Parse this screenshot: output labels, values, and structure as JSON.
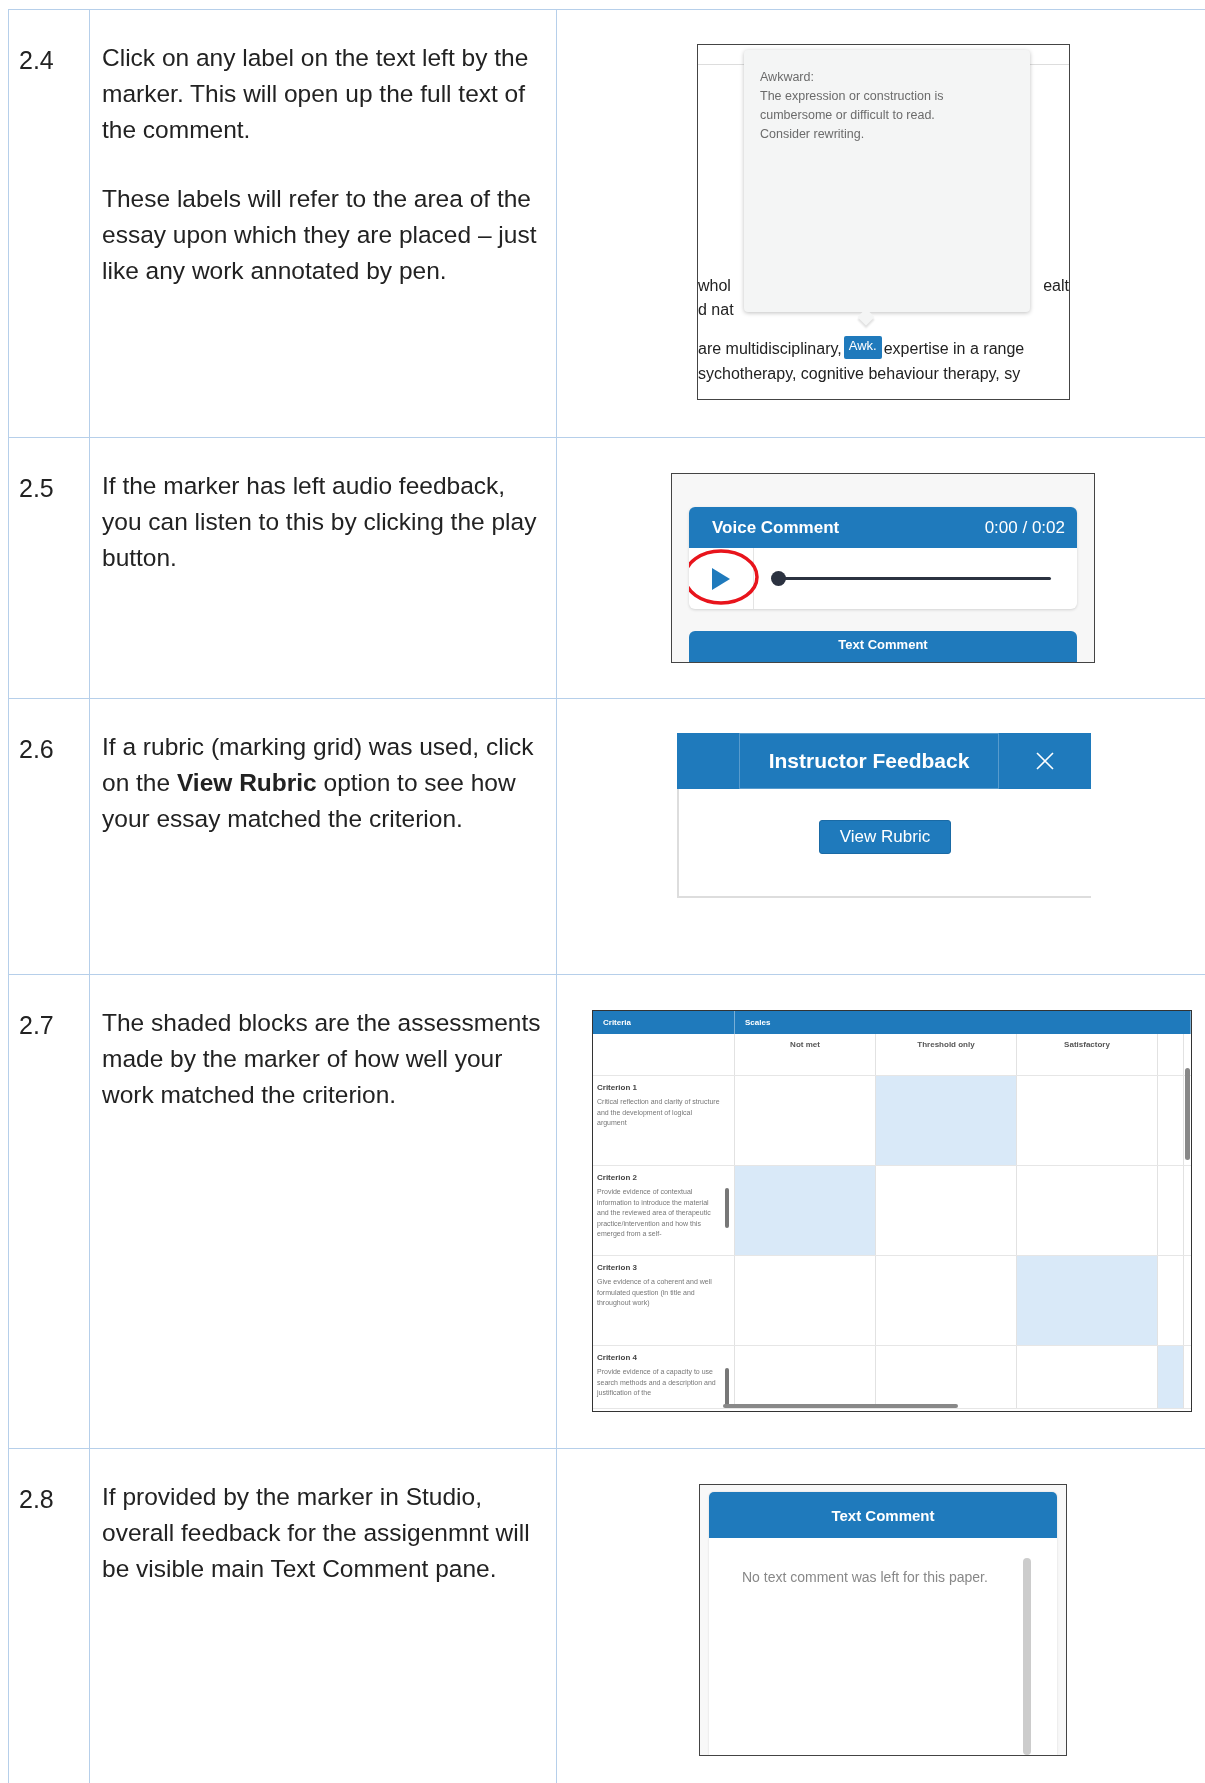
{
  "rows": [
    {
      "number": "2.4",
      "paragraphs": [
        "Click on any label on the text left by the marker. This will open up the full text of the comment.",
        "These labels will refer to the area of the essay upon which they are placed – just like any work annotated by pen."
      ],
      "figure": {
        "kind": "annotation",
        "popup_title": "Awkward:",
        "popup_lines": [
          "The expression or construction is",
          "cumbersome or difficult to read.",
          "Consider rewriting."
        ],
        "line_1_left": "whol",
        "line_1_right": "ealt",
        "line_2": "d nat",
        "line_3_before": "are multidisciplinary,",
        "tag": "Awk.",
        "line_3_after": "expertise in a range",
        "line_4": "sychotherapy, cognitive behaviour therapy, sy"
      }
    },
    {
      "number": "2.5",
      "paragraphs": [
        "If the marker has left audio feedback, you can listen to this by clicking the play button."
      ],
      "figure": {
        "kind": "voice",
        "title": "Voice Comment",
        "time": "0:00 / 0:02",
        "level": 0,
        "highlighted": true,
        "next_panel": "Text Comment"
      }
    },
    {
      "number": "2.6",
      "paragraphs": [
        "If a rubric (marking grid) was used, click on the **View Rubric** option to see how your essay matched the criterion."
      ],
      "figure": {
        "kind": "feedback",
        "title": "Instructor Feedback",
        "button": "View Rubric"
      }
    },
    {
      "number": "2.7",
      "paragraphs": [
        "The shaded blocks are the assessments made by the marker of how well your work matched the criterion."
      ],
      "figure": {
        "kind": "rubric",
        "criteria_heading": "Criteria",
        "scales_heading": "Scales",
        "scales": [
          "Not met",
          "Threshold only",
          "Satisfactory"
        ],
        "criteria": [
          {
            "name": "Criterion 1",
            "description": "Critical reflection and clarity of structure and the development of logical argument",
            "cells": [
              false,
              true,
              false,
              false
            ]
          },
          {
            "name": "Criterion 2",
            "description": "Provide evidence of contextual information to introduce the material and the reviewed area of therapeutic practice/intervention and how this emerged from a self-",
            "cells": [
              true,
              false,
              false,
              false
            ]
          },
          {
            "name": "Criterion 3",
            "description": "Give evidence of a coherent and well formulated question (in title and throughout work)",
            "cells": [
              false,
              false,
              true,
              false
            ]
          },
          {
            "name": "Criterion 4",
            "description": "Provide evidence of a capacity to use search methods and a description and justification of the",
            "cells": [
              false,
              false,
              false,
              true
            ]
          }
        ]
      }
    },
    {
      "number": "2.8",
      "paragraphs": [
        "If provided by the marker in Studio, overall feedback for the assigenmnt will be visible main Text Comment pane."
      ],
      "figure": {
        "kind": "text_comment",
        "title": "Text Comment",
        "message": "No text comment was left for this paper."
      }
    }
  ]
}
